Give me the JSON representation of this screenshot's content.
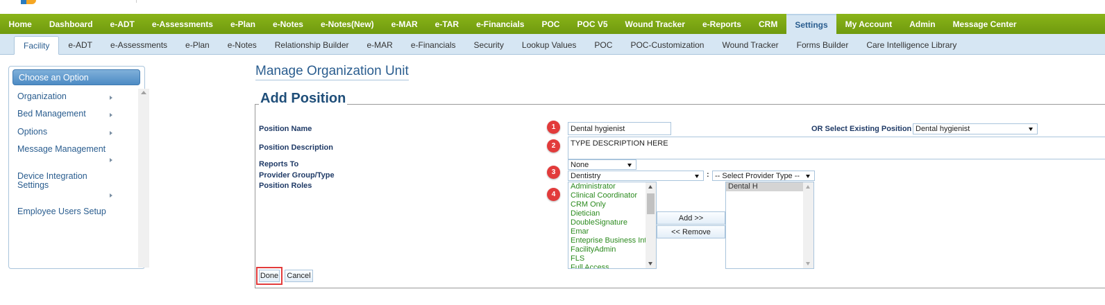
{
  "main_nav": {
    "items": [
      "Home",
      "Dashboard",
      "e-ADT",
      "e-Assessments",
      "e-Plan",
      "e-Notes",
      "e-Notes(New)",
      "e-MAR",
      "e-TAR",
      "e-Financials",
      "POC",
      "POC V5",
      "Wound Tracker",
      "e-Reports",
      "CRM",
      "Settings",
      "My Account",
      "Admin",
      "Message Center"
    ],
    "active": "Settings"
  },
  "sub_nav": {
    "items": [
      "Facility",
      "e-ADT",
      "e-Assessments",
      "e-Plan",
      "e-Notes",
      "Relationship Builder",
      "e-MAR",
      "e-Financials",
      "Security",
      "Lookup Values",
      "POC",
      "POC-Customization",
      "Wound Tracker",
      "Forms Builder",
      "Care Intelligence Library"
    ],
    "active": "Facility"
  },
  "sidebar": {
    "header": "Choose an Option",
    "items": [
      "Organization",
      "Bed Management",
      "Options",
      "Message Management",
      "Device Integration Settings",
      "Employee Users Setup"
    ]
  },
  "page": {
    "title": "Manage Organization Unit",
    "legend": "Add Position"
  },
  "form": {
    "position_name_label": "Position Name",
    "position_name_value": "Dental hygienist",
    "existing_label": "OR Select Existing Position",
    "existing_value": "Dental hygienist",
    "description_label": "Position Description",
    "description_value": "TYPE DESCRIPTION HERE",
    "reports_to_label": "Reports To",
    "reports_to_value": "None",
    "provider_label": "Provider Group/Type",
    "provider_group_value": "Dentistry",
    "provider_sep": ":",
    "provider_type_value": "-- Select Provider Type --",
    "roles_label": "Position Roles",
    "available_roles": [
      "Administrator",
      "Clinical Coordinator",
      "CRM Only",
      "Dietician",
      "DoubleSignature",
      "Emar",
      "Enteprise Business Int",
      "FacilityAdmin",
      "FLS",
      "Full Access"
    ],
    "selected_roles": [
      "Dental H"
    ],
    "add_label": "Add >>",
    "remove_label": "<< Remove",
    "done_label": "Done",
    "cancel_label": "Cancel"
  },
  "badges": [
    "1",
    "2",
    "3",
    "4"
  ],
  "colors": {
    "nav_green": "#7aa514",
    "nav_active": "#d6e6f3",
    "badge_red": "#e23b3b",
    "role_green": "#2b8a1e",
    "title_blue": "#2a5d8f"
  }
}
